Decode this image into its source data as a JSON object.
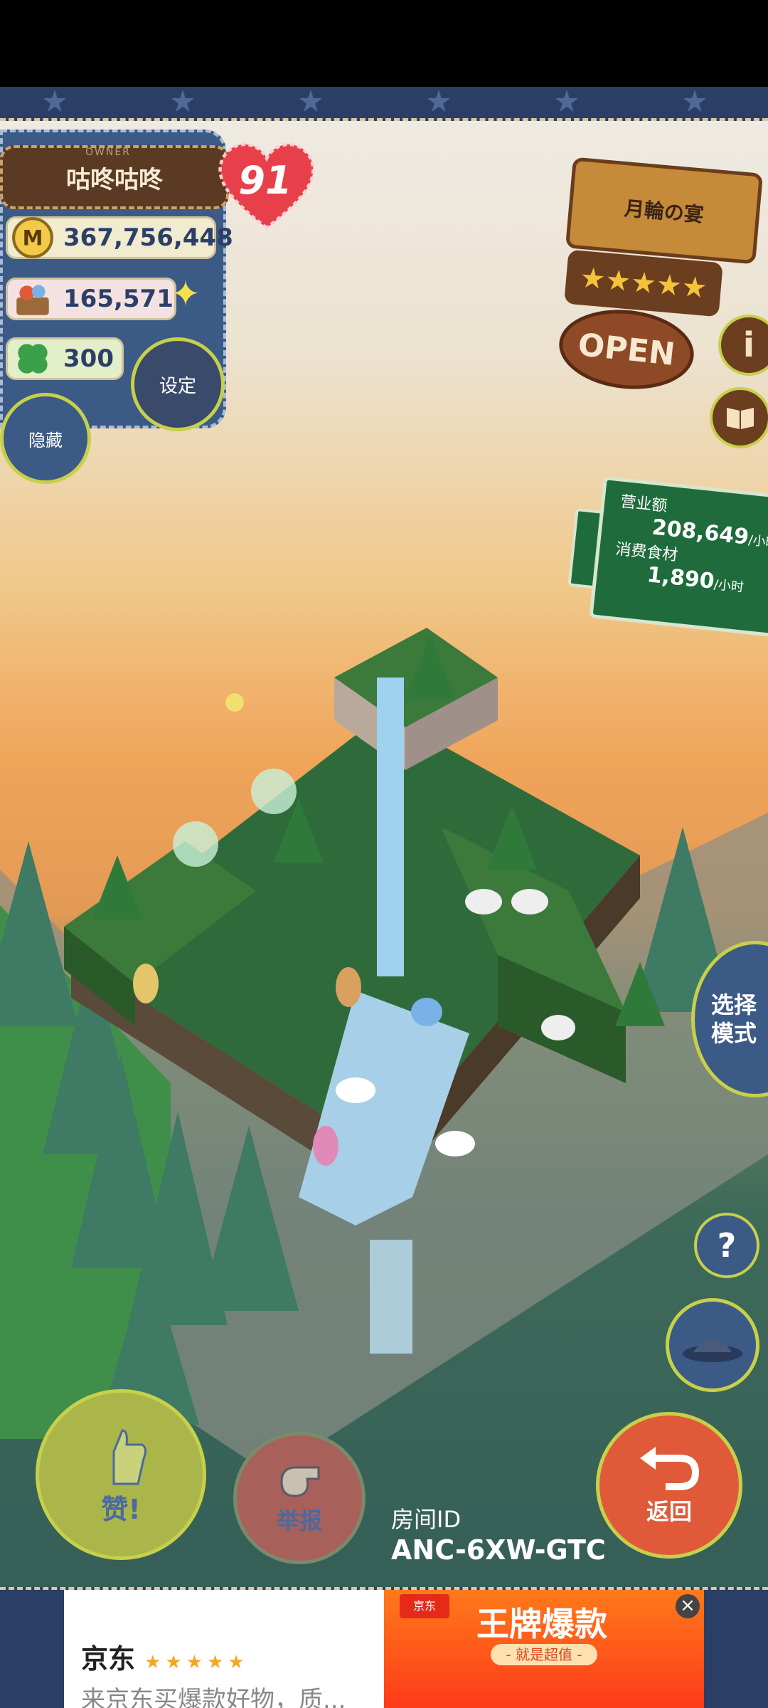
{
  "owner": {
    "label": "OWNER",
    "name": "咕咚咕咚",
    "hearts": "91",
    "money": "367,756,448",
    "food": "165,571",
    "clover": "300"
  },
  "buttons": {
    "settings": "设定",
    "hide": "隐藏",
    "select_mode": "选择模式",
    "help": "?",
    "like": "赞!",
    "report": "举报",
    "back": "返回"
  },
  "shop": {
    "name": "月輪の宴",
    "stars": "★★★★★",
    "status": "OPEN"
  },
  "revenue": {
    "revenue_label": "营业额",
    "revenue_value": "208,649",
    "consume_label": "消费食材",
    "consume_value": "1,890",
    "unit": "/小时"
  },
  "room": {
    "label": "房间ID",
    "id": "ANC-6XW-GTC"
  },
  "ad": {
    "brand": "京东",
    "rating": "★★★★★",
    "desc": "来京东买爆款好物，质...",
    "logo": "京东",
    "title": "王牌爆款",
    "subtitle": "- 就是超值 -",
    "close": "×"
  },
  "icons": {
    "money": "money-coin-icon",
    "food": "food-basket-icon",
    "clover": "clover-icon",
    "info": "info-icon",
    "book": "book-icon",
    "hat": "hat-icon"
  }
}
